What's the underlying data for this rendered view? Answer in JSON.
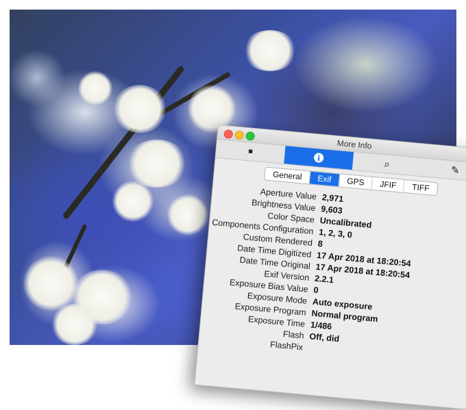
{
  "window": {
    "title": "More Info"
  },
  "toolbar": {
    "items": [
      {
        "icon": "document-icon",
        "glyph": "■"
      },
      {
        "icon": "info-icon",
        "glyph": "i"
      },
      {
        "icon": "search-icon",
        "glyph": "⌕"
      },
      {
        "icon": "pencil-icon",
        "glyph": "✎"
      }
    ]
  },
  "tabs": [
    "General",
    "Exif",
    "GPS",
    "JFIF",
    "TIFF"
  ],
  "selected_tab": "Exif",
  "rows": [
    {
      "label": "Aperture Value",
      "value": "2,971"
    },
    {
      "label": "Brightness Value",
      "value": "9,603"
    },
    {
      "label": "Color Space",
      "value": "Uncalibrated"
    },
    {
      "label": "Components Configuration",
      "value": "1, 2, 3, 0"
    },
    {
      "label": "Custom Rendered",
      "value": "8"
    },
    {
      "label": "Date Time Digitized",
      "value": "17 Apr 2018 at 18:20:54"
    },
    {
      "label": "Date Time Original",
      "value": "17 Apr 2018 at 18:20:54"
    },
    {
      "label": "Exif Version",
      "value": "2.2.1"
    },
    {
      "label": "Exposure Bias Value",
      "value": "0"
    },
    {
      "label": "Exposure Mode",
      "value": "Auto exposure"
    },
    {
      "label": "Exposure Program",
      "value": "Normal program"
    },
    {
      "label": "Exposure Time",
      "value": "1/486"
    },
    {
      "label": "Flash",
      "value": "Off, did"
    },
    {
      "label": "FlashPix",
      "value": ""
    }
  ],
  "colors": {
    "accent": "#1a6fe8",
    "window_bg": "#ececec"
  }
}
